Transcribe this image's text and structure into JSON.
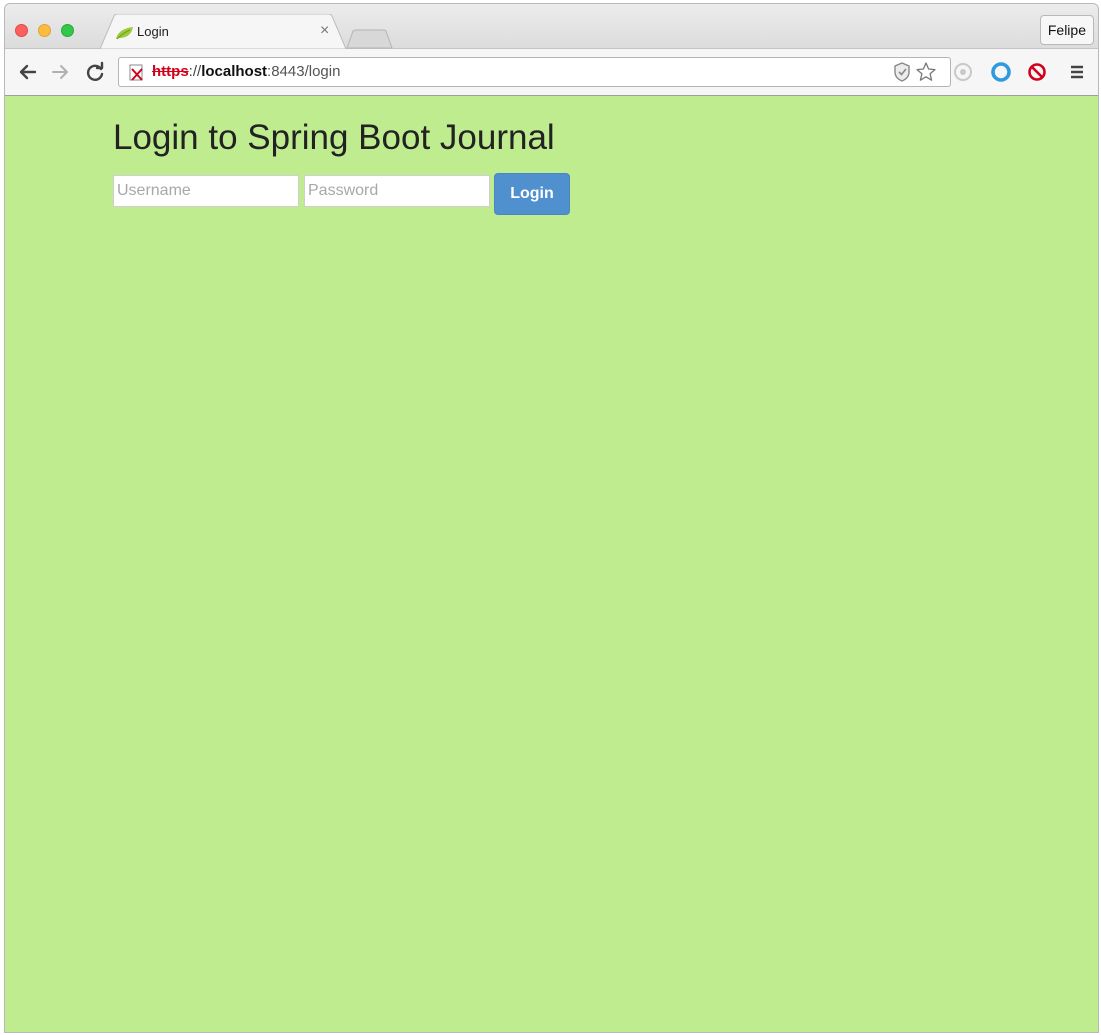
{
  "browser": {
    "tab": {
      "title": "Login",
      "close_glyph": "×",
      "favicon": "spring-leaf-icon"
    },
    "profile": "Felipe",
    "address_bar": {
      "scheme": "https",
      "rest": "://",
      "host": "localhost",
      "path": ":8443/login",
      "security_icon": "insecure-lock-icon"
    },
    "toolbar_icons": [
      "back-arrow-icon",
      "forward-arrow-icon",
      "reload-icon",
      "shield-icon",
      "bookmark-star-icon",
      "extension-circle-icon",
      "extension-ring-icon",
      "block-icon",
      "menu-icon"
    ]
  },
  "page": {
    "background": "#c0ec90",
    "title": "Login to Spring Boot Journal",
    "form": {
      "username_placeholder": "Username",
      "password_placeholder": "Password",
      "username_value": "",
      "password_value": "",
      "submit_label": "Login",
      "submit_color": "#5190cf"
    }
  }
}
